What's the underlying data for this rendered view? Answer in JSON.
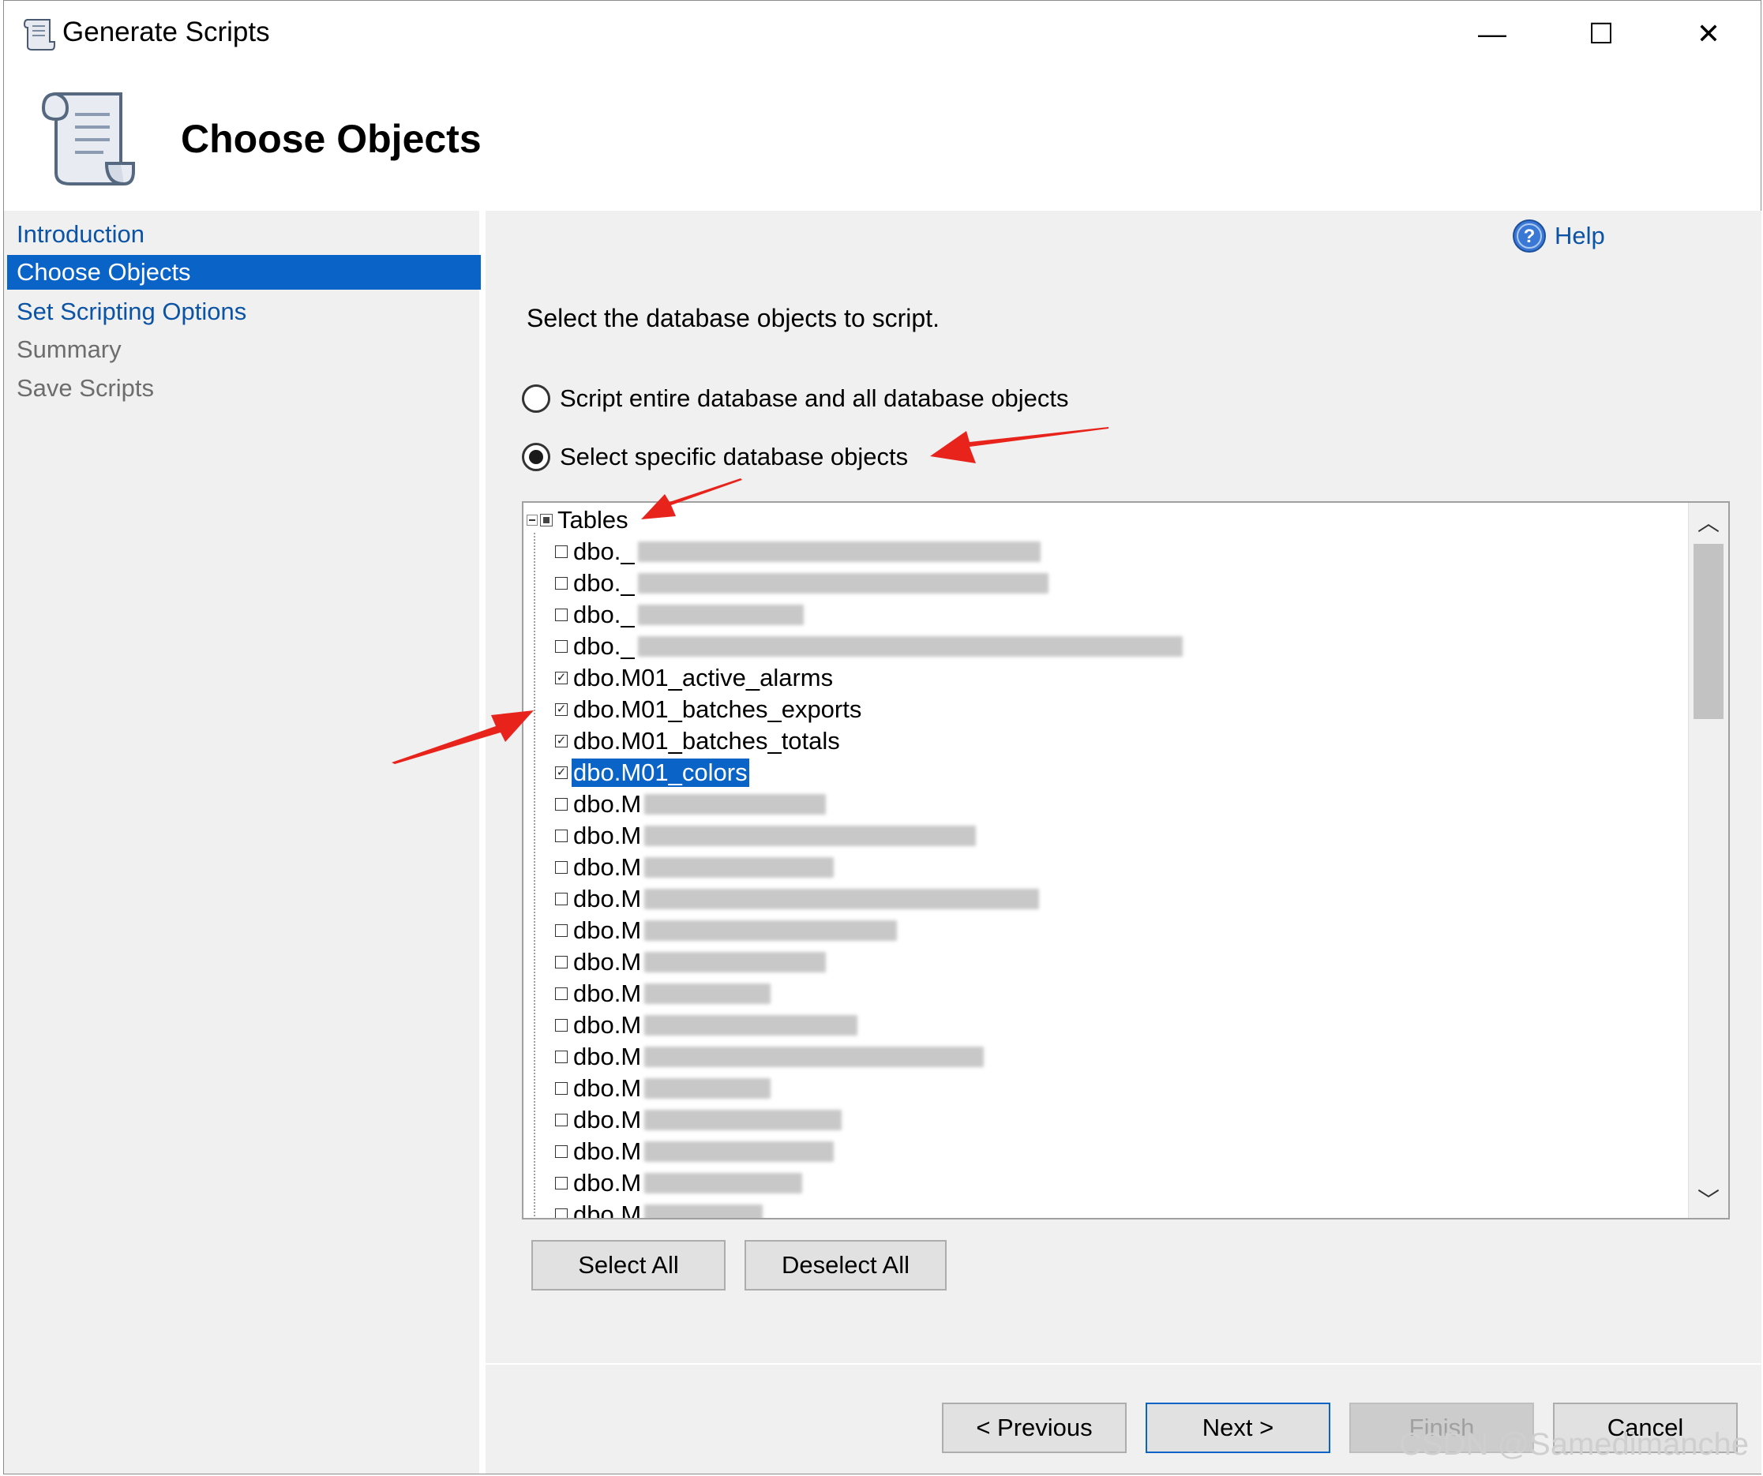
{
  "window": {
    "title": "Generate Scripts",
    "controls": {
      "minimize": "—",
      "maximize": "☐",
      "close": "✕"
    }
  },
  "header": {
    "title": "Choose Objects"
  },
  "nav": {
    "items": [
      {
        "label": "Introduction",
        "state": "link"
      },
      {
        "label": "Choose Objects",
        "state": "active"
      },
      {
        "label": "Set Scripting Options",
        "state": "link"
      },
      {
        "label": "Summary",
        "state": "disabled"
      },
      {
        "label": "Save Scripts",
        "state": "disabled"
      }
    ]
  },
  "help": {
    "label": "Help"
  },
  "main": {
    "instruction": "Select the database objects to script.",
    "radio_entire": "Script entire database and all database objects",
    "radio_specific": "Select specific database objects",
    "selected_radio": "specific"
  },
  "tree": {
    "root_label": "Tables",
    "rows": [
      {
        "label": "dbo._",
        "checked": false
      },
      {
        "label": "dbo._",
        "checked": false
      },
      {
        "label": "dbo._",
        "checked": false
      },
      {
        "label": "dbo._",
        "checked": false
      },
      {
        "label": "dbo.M01_active_alarms",
        "checked": true
      },
      {
        "label": "dbo.M01_batches_exports",
        "checked": true
      },
      {
        "label": "dbo.M01_batches_totals",
        "checked": true
      },
      {
        "label": "dbo.M01_colors",
        "checked": true,
        "selected": true
      },
      {
        "label": "dbo.M",
        "checked": false
      },
      {
        "label": "dbo.M",
        "checked": false
      },
      {
        "label": "dbo.M",
        "checked": false
      },
      {
        "label": "dbo.M",
        "checked": false
      },
      {
        "label": "dbo.M",
        "checked": false
      },
      {
        "label": "dbo.M",
        "checked": false
      },
      {
        "label": "dbo.M",
        "checked": false
      },
      {
        "label": "dbo.M",
        "checked": false
      },
      {
        "label": "dbo.M",
        "checked": false
      },
      {
        "label": "dbo.M",
        "checked": false
      },
      {
        "label": "dbo.M",
        "checked": false
      },
      {
        "label": "dbo.M",
        "checked": false
      },
      {
        "label": "dbo.M",
        "checked": false
      },
      {
        "label": "dbo.M",
        "checked": false
      }
    ]
  },
  "buttons": {
    "select_all": "Select All",
    "deselect_all": "Deselect All",
    "previous": "< Previous",
    "next": "Next >",
    "finish": "Finish",
    "cancel": "Cancel"
  },
  "watermark": "CSDN @Samedimanche",
  "colors": {
    "accent": "#0a64c8",
    "link": "#0b53a5",
    "panel": "#f0f0f0",
    "annotation": "#e8231c"
  }
}
